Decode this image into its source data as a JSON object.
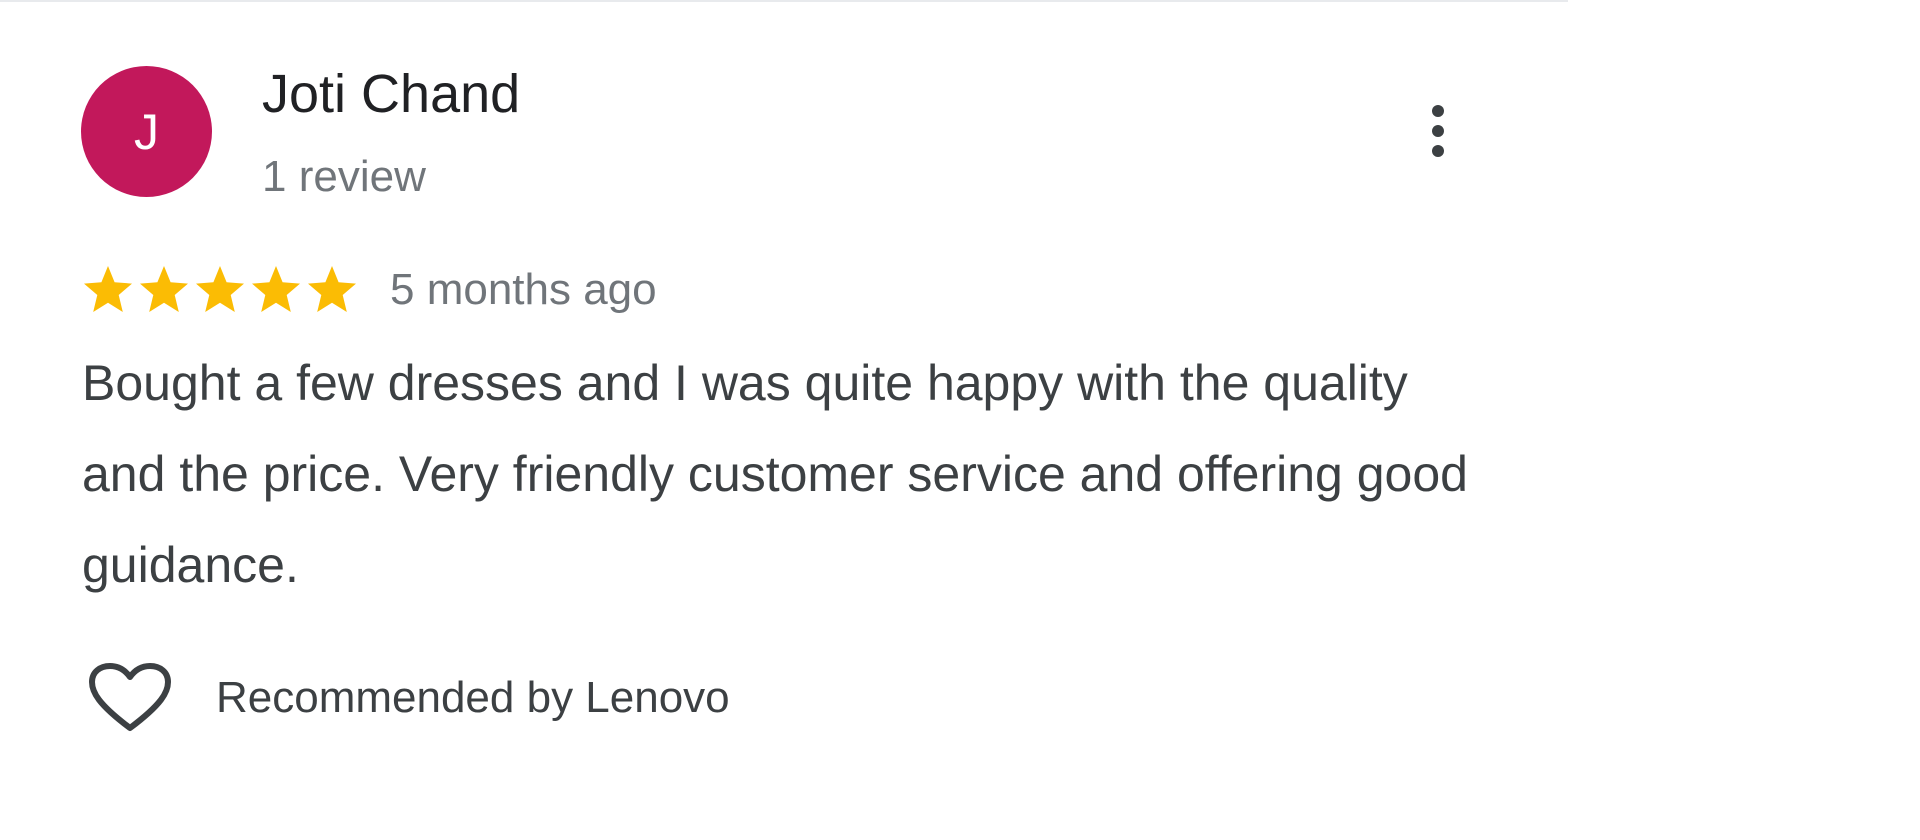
{
  "review": {
    "avatar_initial": "J",
    "author_name": "Joti Chand",
    "review_count": "1 review",
    "rating": 5,
    "rating_max": 5,
    "date": "5 months ago",
    "text": "Bought a few dresses and I was quite happy with the quality and the price. Very friendly customer service and offering good guidance.",
    "helpful_label": "Recommended by Lenovo"
  },
  "colors": {
    "avatar_bg": "#c2185b",
    "star": "#fbbc04",
    "text_primary": "#202124",
    "text_secondary": "#70757a",
    "text_body": "#3c4043"
  },
  "icons": {
    "more": "more-vert-icon",
    "star": "star-icon",
    "helpful": "heart-icon"
  }
}
